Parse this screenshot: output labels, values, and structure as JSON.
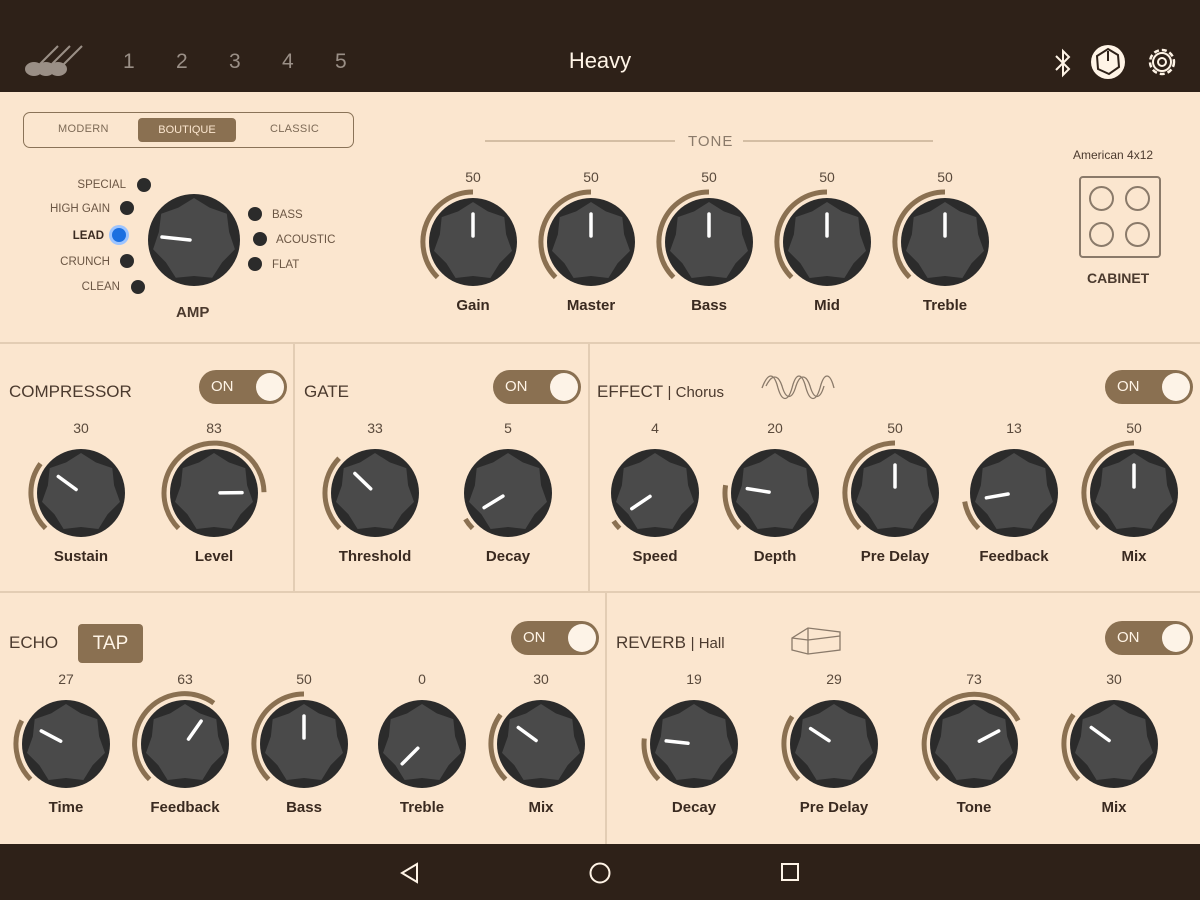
{
  "header": {
    "title": "Heavy",
    "presets": [
      "1",
      "2",
      "3",
      "4",
      "5"
    ],
    "icons": [
      "guitar-logo-icon",
      "bluetooth-icon",
      "amp-power-icon",
      "gear-icon"
    ]
  },
  "amp": {
    "tabs": [
      "MODERN",
      "BOUTIQUE",
      "CLASSIC"
    ],
    "selected_tab": "BOUTIQUE",
    "left_modes": [
      "SPECIAL",
      "HIGH GAIN",
      "LEAD",
      "CRUNCH",
      "CLEAN"
    ],
    "right_modes": [
      "BASS",
      "ACOUSTIC",
      "FLAT"
    ],
    "selected_mode": "LEAD",
    "label": "AMP"
  },
  "tone": {
    "title": "TONE",
    "knobs": [
      {
        "label": "Gain",
        "value": "50"
      },
      {
        "label": "Master",
        "value": "50"
      },
      {
        "label": "Bass",
        "value": "50"
      },
      {
        "label": "Mid",
        "value": "50"
      },
      {
        "label": "Treble",
        "value": "50"
      }
    ]
  },
  "cabinet": {
    "model": "American 4x12",
    "label": "CABINET"
  },
  "compressor": {
    "title": "COMPRESSOR",
    "toggle": "ON",
    "knobs": [
      {
        "label": "Sustain",
        "value": "30"
      },
      {
        "label": "Level",
        "value": "83"
      }
    ]
  },
  "gate": {
    "title": "GATE",
    "toggle": "ON",
    "knobs": [
      {
        "label": "Threshold",
        "value": "33"
      },
      {
        "label": "Decay",
        "value": "5"
      }
    ]
  },
  "effect": {
    "title": "EFFECT",
    "type": "| Chorus",
    "toggle": "ON",
    "knobs": [
      {
        "label": "Speed",
        "value": "4"
      },
      {
        "label": "Depth",
        "value": "20"
      },
      {
        "label": "Pre Delay",
        "value": "50"
      },
      {
        "label": "Feedback",
        "value": "13"
      },
      {
        "label": "Mix",
        "value": "50"
      }
    ]
  },
  "echo": {
    "title": "ECHO",
    "tap": "TAP",
    "toggle": "ON",
    "knobs": [
      {
        "label": "Time",
        "value": "27"
      },
      {
        "label": "Feedback",
        "value": "63"
      },
      {
        "label": "Bass",
        "value": "50"
      },
      {
        "label": "Treble",
        "value": "0"
      },
      {
        "label": "Mix",
        "value": "30"
      }
    ]
  },
  "reverb": {
    "title": "REVERB",
    "type": "| Hall",
    "toggle": "ON",
    "knobs": [
      {
        "label": "Decay",
        "value": "19"
      },
      {
        "label": "Pre Delay",
        "value": "29"
      },
      {
        "label": "Tone",
        "value": "73"
      },
      {
        "label": "Mix",
        "value": "30"
      }
    ]
  },
  "navbar": {
    "icons": [
      "back-icon",
      "home-icon",
      "recents-icon"
    ]
  },
  "colors": {
    "accent": "#8a7051",
    "background": "#fbe6cf",
    "bar": "#2e2118",
    "knob": "#4a4a4a"
  }
}
